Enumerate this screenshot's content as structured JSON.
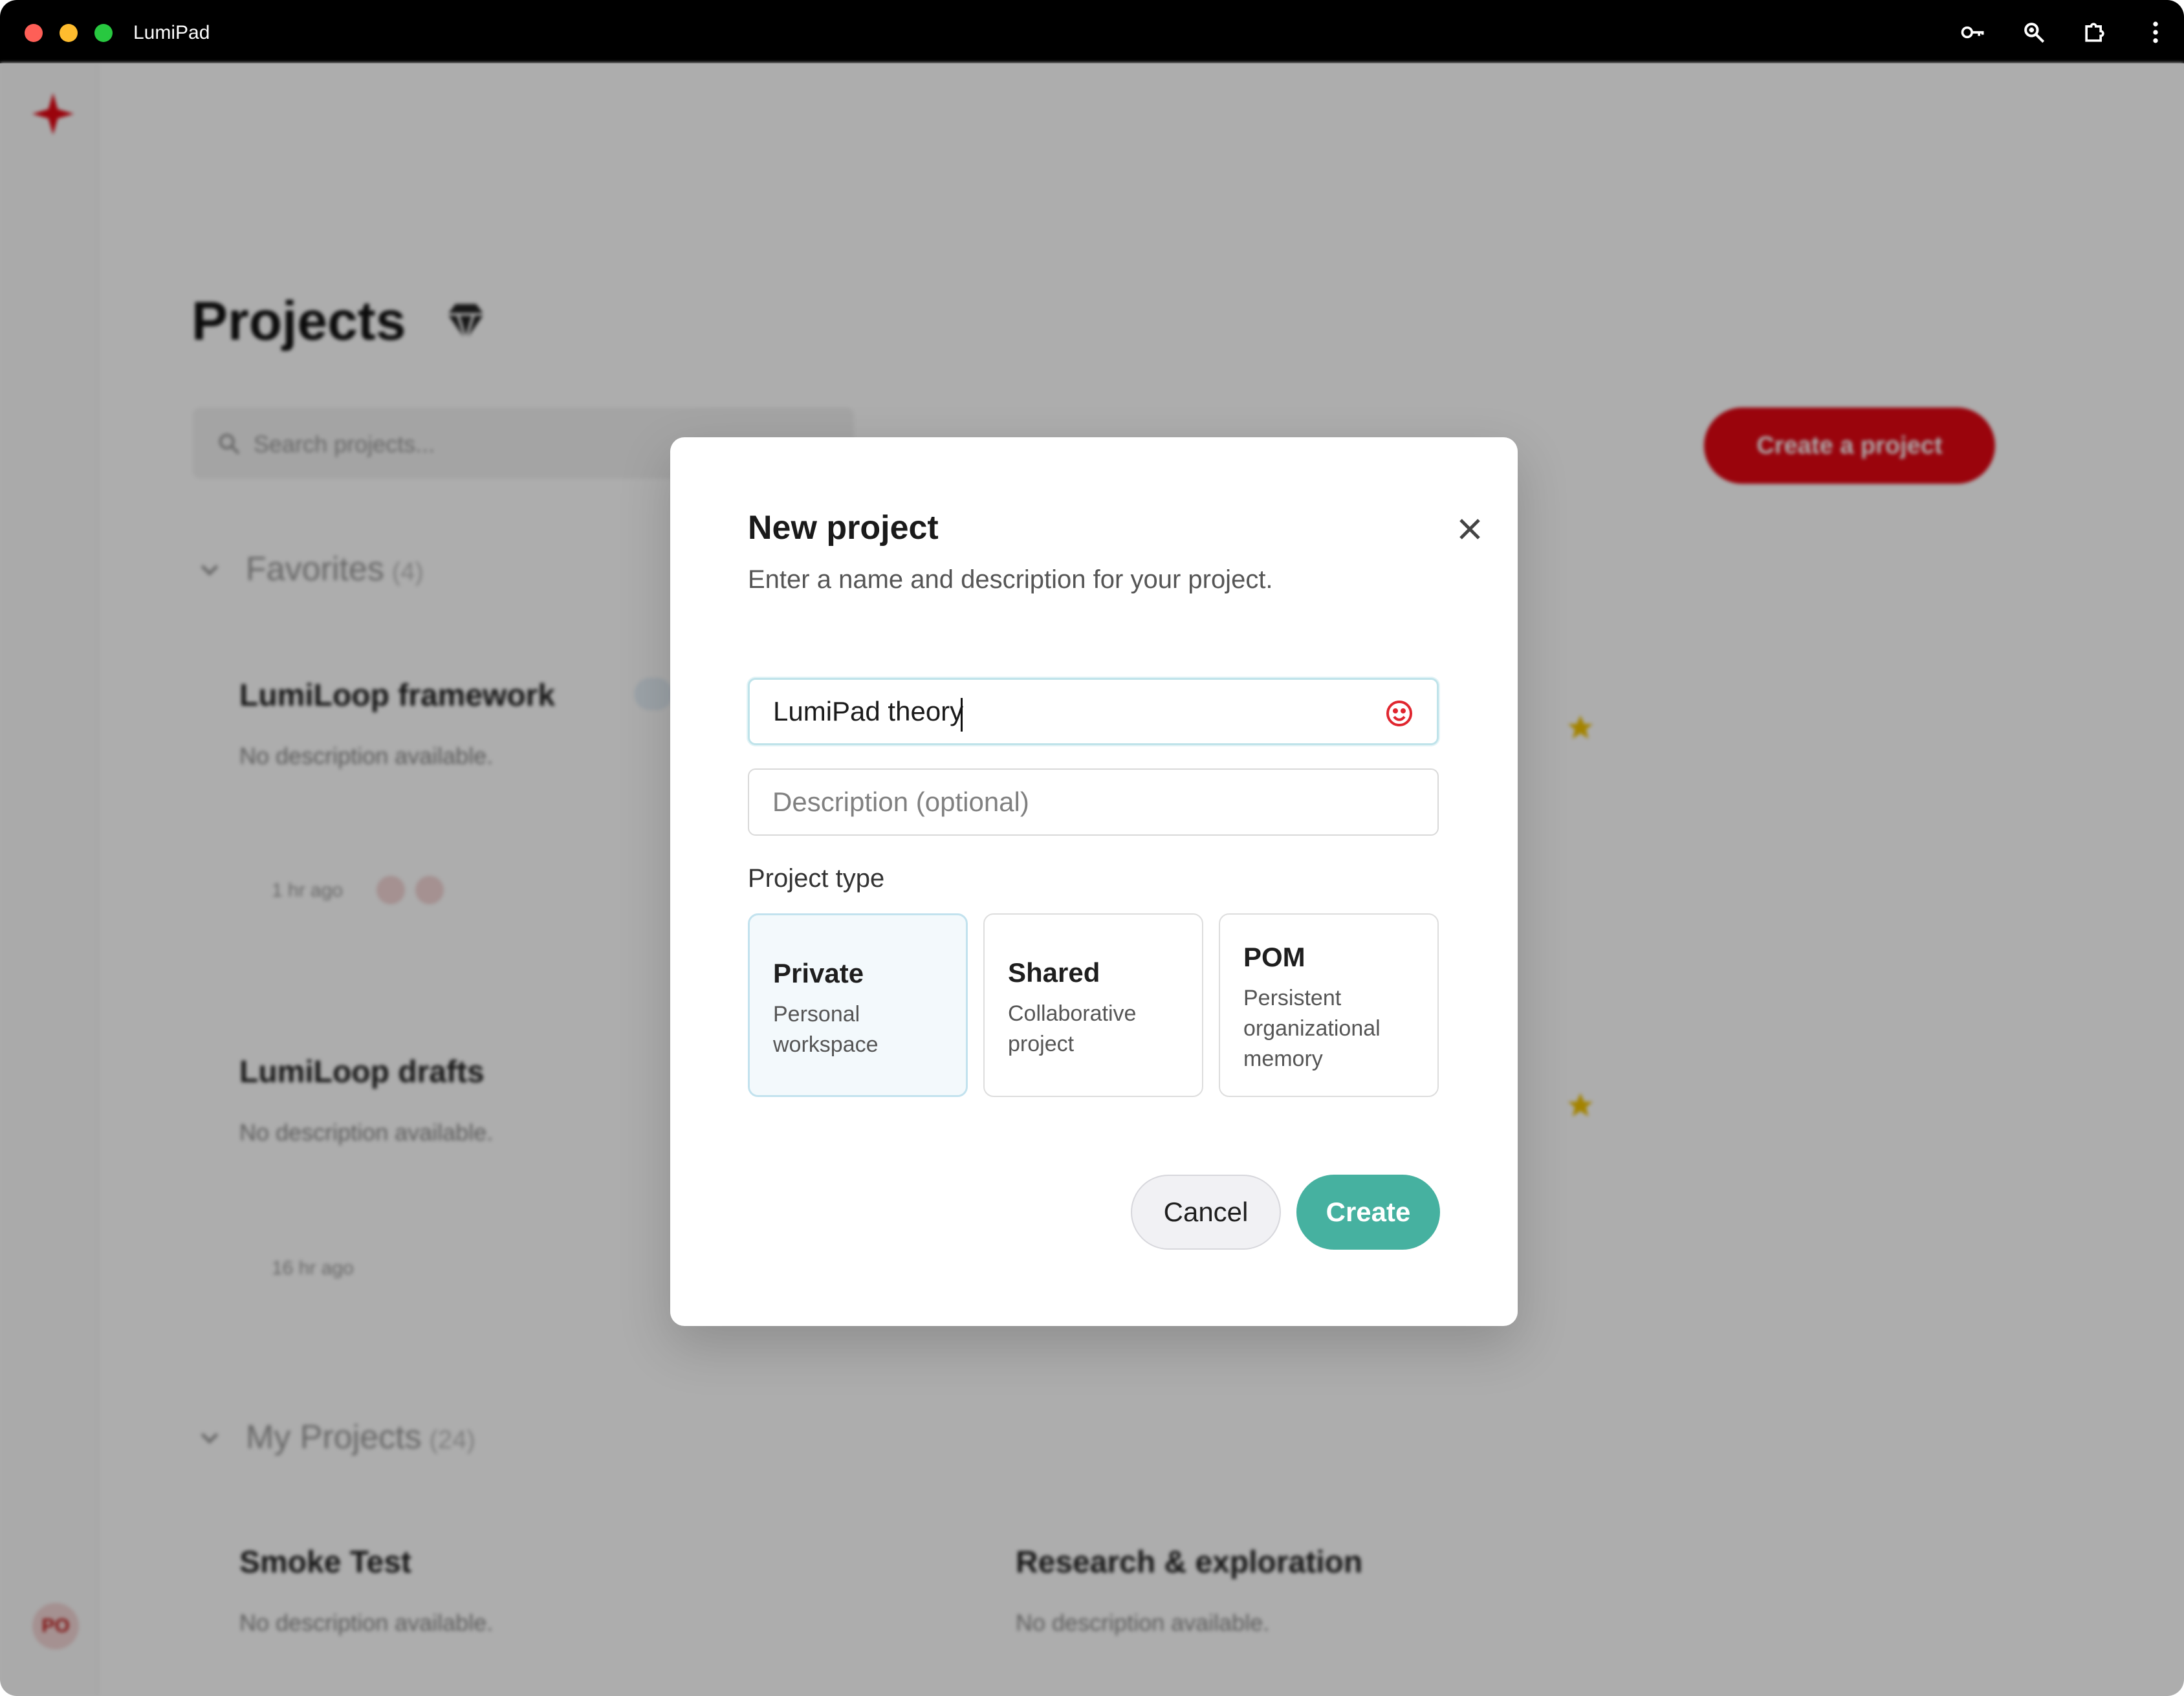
{
  "window": {
    "app_title": "LumiPad"
  },
  "toolbar_icons": [
    "key-icon",
    "zoom-icon",
    "extensions-icon",
    "more-vertical-icon"
  ],
  "background": {
    "page_title": "Projects",
    "search_placeholder": "Search projects...",
    "create_button": "Create a project",
    "favorites": {
      "label": "Favorites",
      "count": "(4)"
    },
    "my_projects": {
      "label": "My Projects",
      "count": "(24)"
    },
    "cards": [
      {
        "title": "LumiLoop framework",
        "desc": "No description available.",
        "meta": "1 hr ago"
      },
      {
        "title": "LumiLoop drafts",
        "desc": "No description available.",
        "meta": "16 hr ago"
      },
      {
        "title": "Smoke Test",
        "desc": "No description available."
      },
      {
        "title": "Research & exploration",
        "desc": "No description available."
      }
    ],
    "avatar": "PO",
    "colors": {
      "brand_red": "#e30613",
      "star": "#f2c200"
    }
  },
  "modal": {
    "title": "New project",
    "subtitle": "Enter a name and description for your project.",
    "name_value": "LumiPad theory",
    "description_placeholder": "Description (optional)",
    "project_type_label": "Project type",
    "types": [
      {
        "title": "Private",
        "desc": "Personal workspace",
        "selected": true
      },
      {
        "title": "Shared",
        "desc": "Collaborative project",
        "selected": false
      },
      {
        "title": "POM",
        "desc": "Persistent organizational memory",
        "selected": false
      }
    ],
    "cancel_label": "Cancel",
    "create_label": "Create",
    "colors": {
      "create_button": "#46b1a0",
      "emoji_icon": "#e0262f",
      "selected_card_bg": "#f3f9fc"
    }
  }
}
